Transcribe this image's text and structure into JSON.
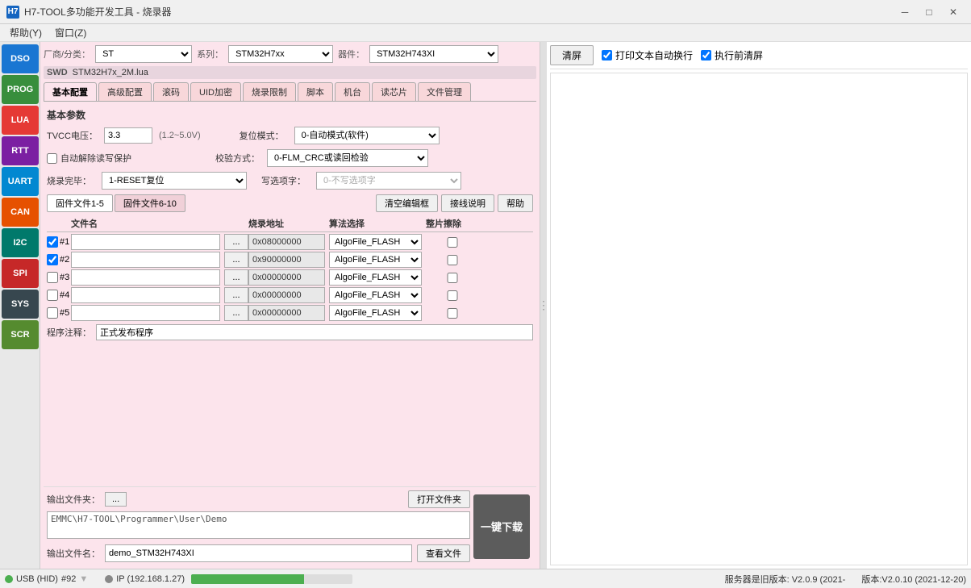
{
  "titlebar": {
    "icon": "H7",
    "title": "H7-TOOL多功能开发工具 - 烧录器",
    "minimize": "─",
    "maximize": "□",
    "close": "✕"
  },
  "menubar": {
    "items": [
      "帮助(Y)",
      "窗口(Z)"
    ]
  },
  "sidebar": {
    "buttons": [
      {
        "id": "dso",
        "label": "DSO",
        "class": "dso"
      },
      {
        "id": "prog",
        "label": "PROG",
        "class": "prog"
      },
      {
        "id": "lua",
        "label": "LUA",
        "class": "lua"
      },
      {
        "id": "rtt",
        "label": "RTT",
        "class": "rtt"
      },
      {
        "id": "uart",
        "label": "UART",
        "class": "uart"
      },
      {
        "id": "can",
        "label": "CAN",
        "class": "can"
      },
      {
        "id": "i2c",
        "label": "I2C",
        "class": "i2c"
      },
      {
        "id": "spi",
        "label": "SPI",
        "class": "spi"
      },
      {
        "id": "sys",
        "label": "SYS",
        "class": "sys"
      },
      {
        "id": "scr",
        "label": "SCR",
        "class": "scr"
      }
    ]
  },
  "device": {
    "manufacturer_label": "厂商/分类：",
    "series_label": "系列：",
    "device_label": "器件：",
    "manufacturer_value": "ST",
    "series_value": "STM32H7xx",
    "device_value": "STM32H743XI",
    "swd_label": "SWD",
    "swd_file": "STM32H7x_2M.lua"
  },
  "tabs": [
    {
      "id": "basic",
      "label": "基本配置",
      "active": true
    },
    {
      "id": "advanced",
      "label": "高级配置"
    },
    {
      "id": "scroll",
      "label": "滚码"
    },
    {
      "id": "uid",
      "label": "UID加密"
    },
    {
      "id": "limit",
      "label": "烧录限制"
    },
    {
      "id": "script",
      "label": "脚本"
    },
    {
      "id": "station",
      "label": "机台"
    },
    {
      "id": "readchip",
      "label": "读芯片"
    },
    {
      "id": "filemanage",
      "label": "文件管理"
    }
  ],
  "params": {
    "section_title": "基本参数",
    "tvcc_label": "TVCC电压：",
    "tvcc_value": "3.3",
    "tvcc_hint": "(1.2~5.0V)",
    "reset_label": "复位模式：",
    "reset_value": "0-自动模式(软件)",
    "auto_unlock_label": "自动解除读写保护",
    "verify_label": "校验方式：",
    "verify_value": "0-FLM_CRC或读回检验",
    "finish_label": "烧录完毕：",
    "finish_value": "1-RESET复位",
    "write_select_label": "写选项字：",
    "write_select_value": "0-不写选项字"
  },
  "files": {
    "tab1_label": "固件文件1-5",
    "tab2_label": "固件文件6-10",
    "btn_clear": "清空编辑框",
    "btn_connect": "接线说明",
    "btn_help": "帮助",
    "col_filename": "文件名",
    "col_address": "烧录地址",
    "col_algo": "算法选择",
    "col_erase": "整片擦除",
    "rows": [
      {
        "id": 1,
        "checked": true,
        "filename": "",
        "address": "0x08000000",
        "algo": "AlgoFile_FLASH"
      },
      {
        "id": 2,
        "checked": true,
        "filename": "",
        "address": "0x90000000",
        "algo": "AlgoFile_FLASH"
      },
      {
        "id": 3,
        "checked": false,
        "filename": "",
        "address": "0x00000000",
        "algo": "AlgoFile_FLASH"
      },
      {
        "id": 4,
        "checked": false,
        "filename": "",
        "address": "0x00000000",
        "algo": "AlgoFile_FLASH"
      },
      {
        "id": 5,
        "checked": false,
        "filename": "",
        "address": "0x00000000",
        "algo": "AlgoFile_FLASH"
      }
    ],
    "note_label": "程序注释：",
    "note_value": "正式发布程序"
  },
  "output": {
    "label": "输出文件夹：",
    "browse_label": "...",
    "open_folder_label": "打开文件夹",
    "path_value": "EMMC\\H7-TOOL\\Programmer\\User\\Demo",
    "filename_label": "输出文件名：",
    "filename_value": "demo_STM32H743XI",
    "view_file_label": "查看文件",
    "download_label": "一键下载"
  },
  "right_panel": {
    "clear_btn_label": "清屏",
    "auto_exec_label": "打印文本自动换行",
    "clear_before_label": "执行前清屏",
    "auto_exec_checked": true,
    "clear_before_checked": true
  },
  "statusbar": {
    "usb_label": "USB (HID)",
    "port_label": "#92",
    "ip_label": "IP (192.168.1.27)",
    "server_version": "服务器是旧版本: V2.0.9 (2021-",
    "version": "版本:V2.0.10 (2021-12-20)"
  }
}
